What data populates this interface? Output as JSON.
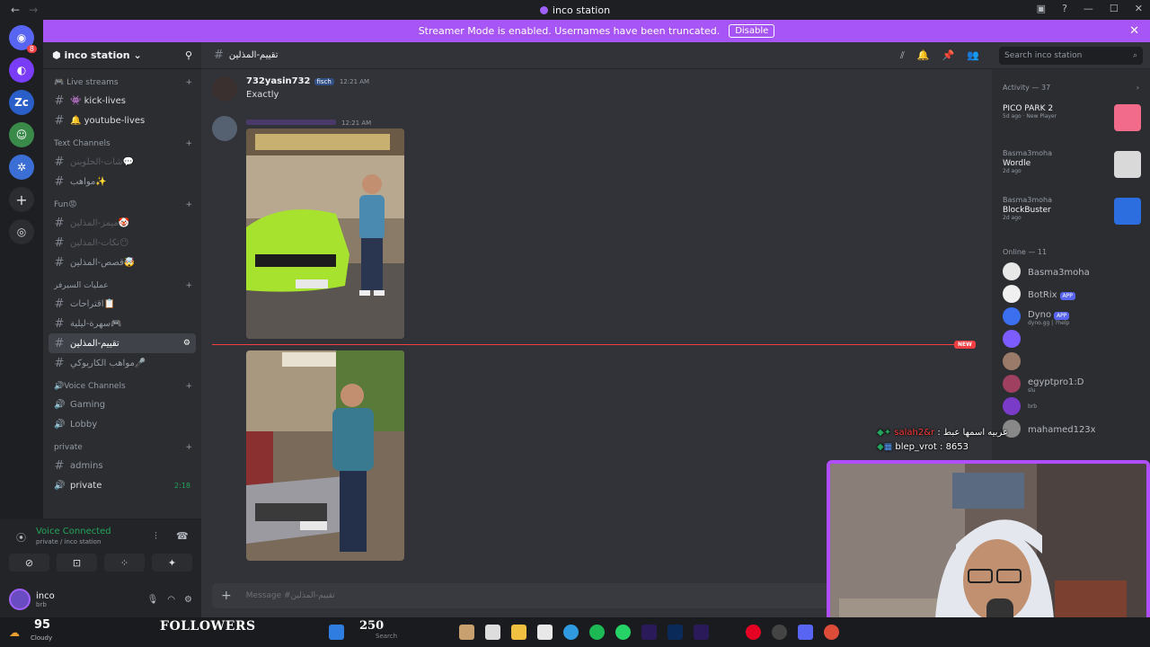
{
  "window": {
    "title": "inco station"
  },
  "banner": {
    "text": "Streamer Mode is enabled. Usernames have been truncated.",
    "button": "Disable"
  },
  "servers": {
    "badge": "8",
    "items": [
      "discord-home",
      "server-purple",
      "Zc",
      "server-avatar",
      "server-blue"
    ]
  },
  "guild": {
    "name": "inco station"
  },
  "sidebar": {
    "items": [
      {
        "type": "cat",
        "label": "🎮 Live streams"
      },
      {
        "type": "chan",
        "label": "👾 kick-lives",
        "style": "bright"
      },
      {
        "type": "chan",
        "label": "🔔 youtube-lives",
        "style": "bright"
      },
      {
        "type": "cat",
        "label": "Text Channels"
      },
      {
        "type": "chan",
        "label": "شات-الحلوينن💬",
        "style": "dim"
      },
      {
        "type": "chan",
        "label": "مواهب✨",
        "style": ""
      },
      {
        "type": "cat",
        "label": "Fun😡"
      },
      {
        "type": "chan",
        "label": "ميمز-المذلين🤡",
        "style": "dim"
      },
      {
        "type": "chan",
        "label": "نكات-المذلين😶",
        "style": "dim"
      },
      {
        "type": "chan",
        "label": "قصص-المذلين🤯",
        "style": ""
      },
      {
        "type": "cat",
        "label": "عمليات السيرفر"
      },
      {
        "type": "chan",
        "label": "اقتراحات📋",
        "style": ""
      },
      {
        "type": "chan",
        "label": "سهرة-ليلية🎮",
        "style": ""
      },
      {
        "type": "chan",
        "label": "تقييم-المذلين",
        "style": "active"
      },
      {
        "type": "chan",
        "label": "مواهب الكاريوكي🎤",
        "style": ""
      },
      {
        "type": "cat",
        "label": "🔊Voice Channels"
      },
      {
        "type": "voice",
        "label": "Gaming",
        "style": ""
      },
      {
        "type": "voice",
        "label": "Lobby",
        "style": ""
      },
      {
        "type": "cat",
        "label": "private"
      },
      {
        "type": "chan",
        "label": "admins",
        "style": ""
      },
      {
        "type": "voice",
        "label": "private",
        "style": "bright",
        "time": "2:18"
      }
    ]
  },
  "voice": {
    "status": "Voice Connected",
    "sub": "private / inco station"
  },
  "user": {
    "name": "inco",
    "status": "brb"
  },
  "channel": {
    "name": "تقييم-المذلين"
  },
  "search": {
    "placeholder": "Search inco station"
  },
  "chat": {
    "msg1": {
      "author": "732yasin732",
      "tag": "fisch",
      "time": "12:21 AM",
      "text": "Exactly"
    },
    "msg2": {
      "time": "12:21 AM"
    },
    "new_label": "NEW",
    "composer_placeholder": "Message #تقييم-المذلين"
  },
  "members": {
    "activity_header": "Activity — 37",
    "activities": [
      {
        "who": "",
        "game": "PICO PARK 2",
        "meta": "5d ago · New Player",
        "thumb": "#f26b8a"
      },
      {
        "who": "Basma3moha",
        "game": "Wordle",
        "meta": "2d ago",
        "thumb": "#d9d9d9"
      },
      {
        "who": "Basma3moha",
        "game": "BlockBuster",
        "meta": "2d ago",
        "thumb": "#2c6ee0"
      }
    ],
    "online_header": "Online — 11",
    "online": [
      {
        "name": "Basma3moha",
        "sub": "",
        "app": "",
        "color": "#e8e8e8"
      },
      {
        "name": "BotRix",
        "sub": "",
        "app": "APP",
        "color": "#f0f0f0"
      },
      {
        "name": "Dyno",
        "sub": "dyno.gg | ?help",
        "app": "APP",
        "color": "#3b6ff0"
      },
      {
        "name": "",
        "sub": "",
        "app": "",
        "color": "#7c5cff"
      },
      {
        "name": "",
        "sub": "",
        "app": "",
        "color": "#9a7b6a"
      },
      {
        "name": "egyptpro1:D",
        "sub": "slu",
        "app": "",
        "color": "#a04060"
      },
      {
        "name": "",
        "sub": "brb",
        "app": "",
        "color": "#7a3cc8"
      },
      {
        "name": "mahamed123x",
        "sub": "",
        "app": "",
        "color": "#888"
      }
    ]
  },
  "overlay": {
    "line1_user": "salah2&r",
    "line1_text": ": عربيه اسمها عبط",
    "line2_user": "blep_vrot",
    "line2_text": ": 8653"
  },
  "taskbar": {
    "temp": "95",
    "weather": "Cloudy",
    "followers_label": "FOLLOWERS",
    "followers_count": "250",
    "search": "Search"
  }
}
